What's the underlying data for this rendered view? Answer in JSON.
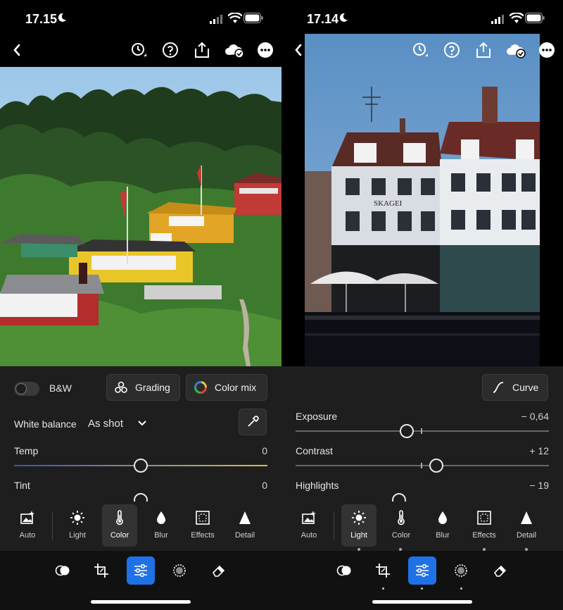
{
  "left": {
    "status": {
      "time": "17.15"
    },
    "panel": {
      "bw_label": "B&W",
      "grading_label": "Grading",
      "colormix_label": "Color mix",
      "wb_label": "White balance",
      "wb_value": "As shot",
      "temp": {
        "label": "Temp",
        "value": "0"
      },
      "tint": {
        "label": "Tint",
        "value": "0"
      }
    },
    "tools": [
      {
        "label": "Auto",
        "icon": "auto-icon"
      },
      {
        "label": "Light",
        "icon": "sun-icon"
      },
      {
        "label": "Color",
        "icon": "thermometer-icon",
        "active": true
      },
      {
        "label": "Blur",
        "icon": "drop-icon"
      },
      {
        "label": "Effects",
        "icon": "effects-icon"
      },
      {
        "label": "Detail",
        "icon": "triangle-icon"
      }
    ]
  },
  "right": {
    "status": {
      "time": "17.14"
    },
    "panel": {
      "curve_label": "Curve",
      "exposure": {
        "label": "Exposure",
        "value": "− 0,64"
      },
      "contrast": {
        "label": "Contrast",
        "value": "+ 12"
      },
      "highlights": {
        "label": "Highlights",
        "value": "− 19"
      }
    },
    "tools": [
      {
        "label": "Auto",
        "icon": "auto-icon"
      },
      {
        "label": "Light",
        "icon": "sun-icon",
        "active": true
      },
      {
        "label": "Color",
        "icon": "thermometer-icon"
      },
      {
        "label": "Blur",
        "icon": "drop-icon"
      },
      {
        "label": "Effects",
        "icon": "effects-icon"
      },
      {
        "label": "Detail",
        "icon": "triangle-icon"
      }
    ]
  },
  "photo_sign": "SKAGEI",
  "nav_icons": [
    "masking-icon",
    "crop-icon",
    "edit-sliders-icon",
    "healing-icon",
    "eraser-icon"
  ],
  "colors": {
    "accent": "#1f72e6",
    "panel": "#1e1e1e"
  }
}
